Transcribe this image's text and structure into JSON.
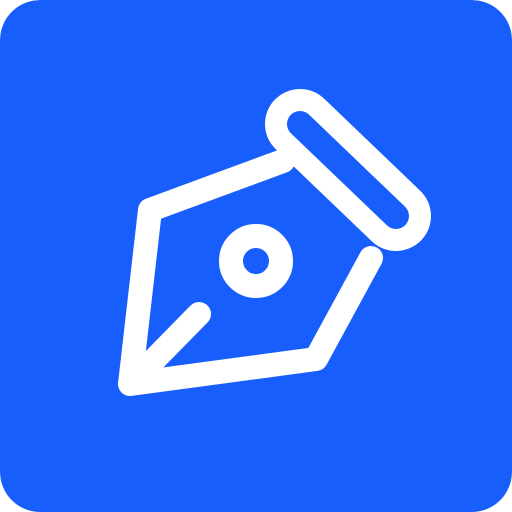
{
  "app_icon": {
    "icon_name": "pen-nib-icon",
    "background_color": "#175EFD",
    "foreground_color": "#FFFFFF"
  }
}
